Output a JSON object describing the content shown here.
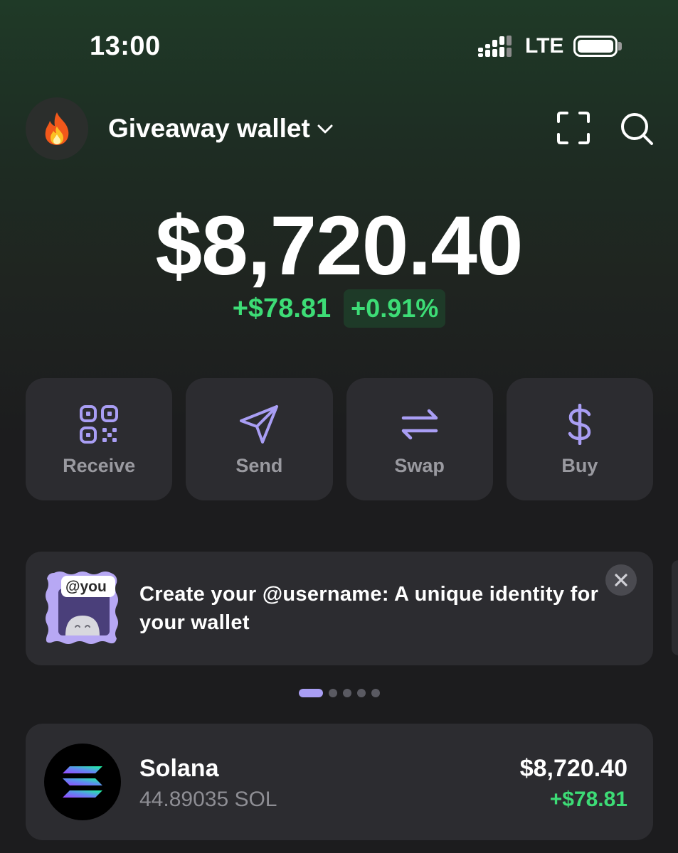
{
  "status_bar": {
    "time": "13:00",
    "network": "LTE"
  },
  "header": {
    "avatar_icon": "fire-emoji",
    "wallet_name": "Giveaway wallet",
    "scan_icon": "scan-icon",
    "search_icon": "search-icon"
  },
  "balance": {
    "total": "$8,720.40",
    "change_abs": "+$78.81",
    "change_pct": "+0.91%"
  },
  "actions": [
    {
      "label": "Receive",
      "icon": "qr-code-icon"
    },
    {
      "label": "Send",
      "icon": "send-icon"
    },
    {
      "label": "Swap",
      "icon": "swap-icon"
    },
    {
      "label": "Buy",
      "icon": "dollar-icon"
    }
  ],
  "promo": {
    "badge_text": "@you",
    "text": "Create your @username: A unique identity for your wallet",
    "pager_count": 5,
    "pager_active": 0
  },
  "tokens": [
    {
      "name": "Solana",
      "amount": "44.89035 SOL",
      "value": "$8,720.40",
      "change": "+$78.81"
    }
  ],
  "colors": {
    "accent": "#a99ef4",
    "positive": "#3ddc76",
    "card": "#2c2c30",
    "muted_text": "#9a9aa0"
  }
}
